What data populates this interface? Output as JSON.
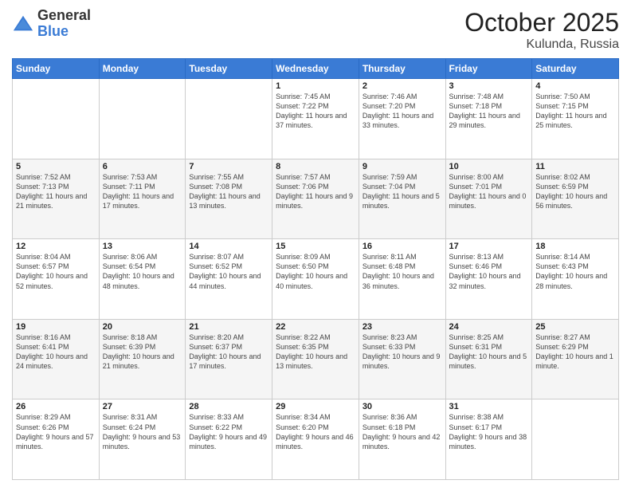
{
  "header": {
    "logo_general": "General",
    "logo_blue": "Blue",
    "month_title": "October 2025",
    "location": "Kulunda, Russia"
  },
  "days_of_week": [
    "Sunday",
    "Monday",
    "Tuesday",
    "Wednesday",
    "Thursday",
    "Friday",
    "Saturday"
  ],
  "weeks": [
    {
      "days": [
        {
          "num": "",
          "info": ""
        },
        {
          "num": "",
          "info": ""
        },
        {
          "num": "",
          "info": ""
        },
        {
          "num": "1",
          "info": "Sunrise: 7:45 AM\nSunset: 7:22 PM\nDaylight: 11 hours\nand 37 minutes."
        },
        {
          "num": "2",
          "info": "Sunrise: 7:46 AM\nSunset: 7:20 PM\nDaylight: 11 hours\nand 33 minutes."
        },
        {
          "num": "3",
          "info": "Sunrise: 7:48 AM\nSunset: 7:18 PM\nDaylight: 11 hours\nand 29 minutes."
        },
        {
          "num": "4",
          "info": "Sunrise: 7:50 AM\nSunset: 7:15 PM\nDaylight: 11 hours\nand 25 minutes."
        }
      ]
    },
    {
      "days": [
        {
          "num": "5",
          "info": "Sunrise: 7:52 AM\nSunset: 7:13 PM\nDaylight: 11 hours\nand 21 minutes."
        },
        {
          "num": "6",
          "info": "Sunrise: 7:53 AM\nSunset: 7:11 PM\nDaylight: 11 hours\nand 17 minutes."
        },
        {
          "num": "7",
          "info": "Sunrise: 7:55 AM\nSunset: 7:08 PM\nDaylight: 11 hours\nand 13 minutes."
        },
        {
          "num": "8",
          "info": "Sunrise: 7:57 AM\nSunset: 7:06 PM\nDaylight: 11 hours\nand 9 minutes."
        },
        {
          "num": "9",
          "info": "Sunrise: 7:59 AM\nSunset: 7:04 PM\nDaylight: 11 hours\nand 5 minutes."
        },
        {
          "num": "10",
          "info": "Sunrise: 8:00 AM\nSunset: 7:01 PM\nDaylight: 11 hours\nand 0 minutes."
        },
        {
          "num": "11",
          "info": "Sunrise: 8:02 AM\nSunset: 6:59 PM\nDaylight: 10 hours\nand 56 minutes."
        }
      ]
    },
    {
      "days": [
        {
          "num": "12",
          "info": "Sunrise: 8:04 AM\nSunset: 6:57 PM\nDaylight: 10 hours\nand 52 minutes."
        },
        {
          "num": "13",
          "info": "Sunrise: 8:06 AM\nSunset: 6:54 PM\nDaylight: 10 hours\nand 48 minutes."
        },
        {
          "num": "14",
          "info": "Sunrise: 8:07 AM\nSunset: 6:52 PM\nDaylight: 10 hours\nand 44 minutes."
        },
        {
          "num": "15",
          "info": "Sunrise: 8:09 AM\nSunset: 6:50 PM\nDaylight: 10 hours\nand 40 minutes."
        },
        {
          "num": "16",
          "info": "Sunrise: 8:11 AM\nSunset: 6:48 PM\nDaylight: 10 hours\nand 36 minutes."
        },
        {
          "num": "17",
          "info": "Sunrise: 8:13 AM\nSunset: 6:46 PM\nDaylight: 10 hours\nand 32 minutes."
        },
        {
          "num": "18",
          "info": "Sunrise: 8:14 AM\nSunset: 6:43 PM\nDaylight: 10 hours\nand 28 minutes."
        }
      ]
    },
    {
      "days": [
        {
          "num": "19",
          "info": "Sunrise: 8:16 AM\nSunset: 6:41 PM\nDaylight: 10 hours\nand 24 minutes."
        },
        {
          "num": "20",
          "info": "Sunrise: 8:18 AM\nSunset: 6:39 PM\nDaylight: 10 hours\nand 21 minutes."
        },
        {
          "num": "21",
          "info": "Sunrise: 8:20 AM\nSunset: 6:37 PM\nDaylight: 10 hours\nand 17 minutes."
        },
        {
          "num": "22",
          "info": "Sunrise: 8:22 AM\nSunset: 6:35 PM\nDaylight: 10 hours\nand 13 minutes."
        },
        {
          "num": "23",
          "info": "Sunrise: 8:23 AM\nSunset: 6:33 PM\nDaylight: 10 hours\nand 9 minutes."
        },
        {
          "num": "24",
          "info": "Sunrise: 8:25 AM\nSunset: 6:31 PM\nDaylight: 10 hours\nand 5 minutes."
        },
        {
          "num": "25",
          "info": "Sunrise: 8:27 AM\nSunset: 6:29 PM\nDaylight: 10 hours\nand 1 minute."
        }
      ]
    },
    {
      "days": [
        {
          "num": "26",
          "info": "Sunrise: 8:29 AM\nSunset: 6:26 PM\nDaylight: 9 hours\nand 57 minutes."
        },
        {
          "num": "27",
          "info": "Sunrise: 8:31 AM\nSunset: 6:24 PM\nDaylight: 9 hours\nand 53 minutes."
        },
        {
          "num": "28",
          "info": "Sunrise: 8:33 AM\nSunset: 6:22 PM\nDaylight: 9 hours\nand 49 minutes."
        },
        {
          "num": "29",
          "info": "Sunrise: 8:34 AM\nSunset: 6:20 PM\nDaylight: 9 hours\nand 46 minutes."
        },
        {
          "num": "30",
          "info": "Sunrise: 8:36 AM\nSunset: 6:18 PM\nDaylight: 9 hours\nand 42 minutes."
        },
        {
          "num": "31",
          "info": "Sunrise: 8:38 AM\nSunset: 6:17 PM\nDaylight: 9 hours\nand 38 minutes."
        },
        {
          "num": "",
          "info": ""
        }
      ]
    }
  ]
}
